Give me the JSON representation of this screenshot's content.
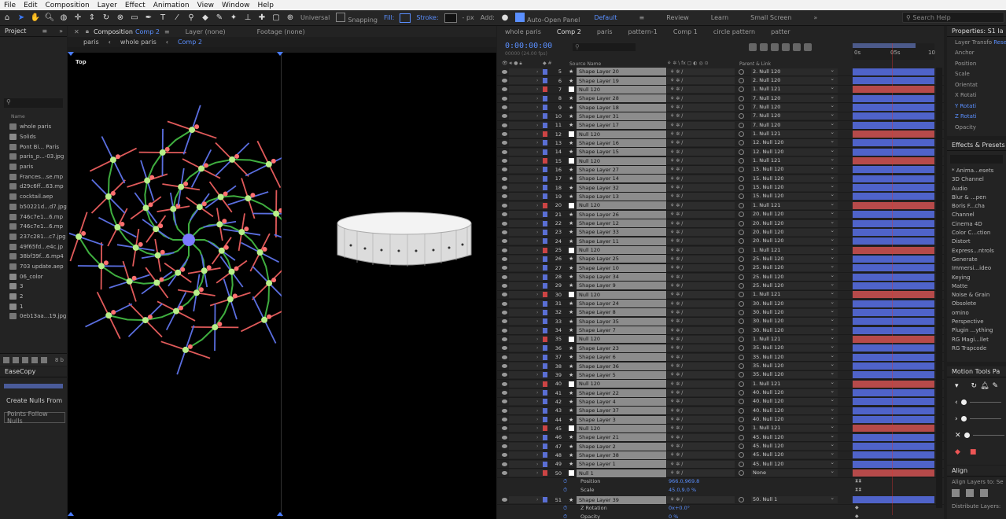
{
  "menubar": [
    "File",
    "Edit",
    "Composition",
    "Layer",
    "Effect",
    "Animation",
    "View",
    "Window",
    "Help"
  ],
  "toolbar": {
    "universal": "Universal",
    "snapping": "Snapping",
    "fill": "Fill:",
    "stroke": "Stroke:",
    "px": "- px",
    "add": "Add:",
    "auto_open": "Auto-Open Panel",
    "workspaces": [
      "Default",
      "Review",
      "Learn",
      "Small Screen"
    ],
    "search_help": "Search Help"
  },
  "project": {
    "title": "Project",
    "col_name": "Name",
    "items": [
      {
        "name": "whole paris",
        "type": "comp"
      },
      {
        "name": "Solids",
        "type": "folder"
      },
      {
        "name": "Pont Bi... Paris",
        "type": "file"
      },
      {
        "name": "paris_p...-03.jpg",
        "type": "file"
      },
      {
        "name": "paris",
        "type": "comp"
      },
      {
        "name": "Frances...se.mp",
        "type": "file"
      },
      {
        "name": "d29c6ff...63.mp",
        "type": "file"
      },
      {
        "name": "cocktail.aep",
        "type": "file"
      },
      {
        "name": "b50221d...d7.jpg",
        "type": "file"
      },
      {
        "name": "746c7e1...6.mp",
        "type": "file"
      },
      {
        "name": "746c7e1...6.mp",
        "type": "file"
      },
      {
        "name": "237c281...c7.jpg",
        "type": "file"
      },
      {
        "name": "49f65fd...e4c.jp",
        "type": "file"
      },
      {
        "name": "38bf39f...6.mp4",
        "type": "file"
      },
      {
        "name": "703 update.aep",
        "type": "file"
      },
      {
        "name": "06_color",
        "type": "folder"
      },
      {
        "name": "3",
        "type": "folder"
      },
      {
        "name": "2",
        "type": "folder"
      },
      {
        "name": "1",
        "type": "folder"
      },
      {
        "name": "0eb13aa...19.jpg",
        "type": "file"
      }
    ],
    "bpc": "8 b"
  },
  "easecopy": {
    "title": "EaseCopy",
    "create_nulls": "Create Nulls From",
    "points_follow": "Points Follow Nulls"
  },
  "viewer": {
    "tabs": [
      "Composition",
      "Comp 2",
      "Layer (none)",
      "Footage (none)"
    ],
    "breadcrumb": [
      "paris",
      "whole paris",
      "Comp 2"
    ],
    "camera": "Top"
  },
  "timeline": {
    "tabs": [
      "whole paris",
      "Comp 2",
      "paris",
      "pattern-1",
      "Comp 1",
      "circle pattern",
      "patter"
    ],
    "time": "0:00:00:00",
    "fps": "00000 (24.00 fps)",
    "col_source": "Source Name",
    "col_parent": "Parent & Link",
    "ruler": [
      "0s",
      "05s",
      "10"
    ],
    "layers": [
      {
        "n": "5",
        "name": "Shape Layer 20",
        "parent": "2. Null 120",
        "c": "#5a6fd4",
        "t": "s"
      },
      {
        "n": "6",
        "name": "Shape Layer 19",
        "parent": "2. Null 120",
        "c": "#5a6fd4",
        "t": "s"
      },
      {
        "n": "7",
        "name": "Null 120",
        "parent": "1. Null 121",
        "c": "#c44",
        "t": "n"
      },
      {
        "n": "8",
        "name": "Shape Layer 28",
        "parent": "7. Null 120",
        "c": "#5a6fd4",
        "t": "s"
      },
      {
        "n": "9",
        "name": "Shape Layer 18",
        "parent": "7. Null 120",
        "c": "#5a6fd4",
        "t": "s"
      },
      {
        "n": "10",
        "name": "Shape Layer 31",
        "parent": "7. Null 120",
        "c": "#5a6fd4",
        "t": "s"
      },
      {
        "n": "11",
        "name": "Shape Layer 17",
        "parent": "7. Null 120",
        "c": "#5a6fd4",
        "t": "s"
      },
      {
        "n": "12",
        "name": "Null 120",
        "parent": "1. Null 121",
        "c": "#c44",
        "t": "n"
      },
      {
        "n": "13",
        "name": "Shape Layer 16",
        "parent": "12. Null 120",
        "c": "#5a6fd4",
        "t": "s"
      },
      {
        "n": "14",
        "name": "Shape Layer 15",
        "parent": "12. Null 120",
        "c": "#5a6fd4",
        "t": "s"
      },
      {
        "n": "15",
        "name": "Null 120",
        "parent": "1. Null 121",
        "c": "#c44",
        "t": "n"
      },
      {
        "n": "16",
        "name": "Shape Layer 27",
        "parent": "15. Null 120",
        "c": "#5a6fd4",
        "t": "s"
      },
      {
        "n": "17",
        "name": "Shape Layer 14",
        "parent": "15. Null 120",
        "c": "#5a6fd4",
        "t": "s"
      },
      {
        "n": "18",
        "name": "Shape Layer 32",
        "parent": "15. Null 120",
        "c": "#5a6fd4",
        "t": "s"
      },
      {
        "n": "19",
        "name": "Shape Layer 13",
        "parent": "15. Null 120",
        "c": "#5a6fd4",
        "t": "s"
      },
      {
        "n": "20",
        "name": "Null 120",
        "parent": "1. Null 121",
        "c": "#c44",
        "t": "n"
      },
      {
        "n": "21",
        "name": "Shape Layer 26",
        "parent": "20. Null 120",
        "c": "#5a6fd4",
        "t": "s"
      },
      {
        "n": "22",
        "name": "Shape Layer 12",
        "parent": "20. Null 120",
        "c": "#5a6fd4",
        "t": "s"
      },
      {
        "n": "23",
        "name": "Shape Layer 33",
        "parent": "20. Null 120",
        "c": "#5a6fd4",
        "t": "s"
      },
      {
        "n": "24",
        "name": "Shape Layer 11",
        "parent": "20. Null 120",
        "c": "#5a6fd4",
        "t": "s"
      },
      {
        "n": "25",
        "name": "Null 120",
        "parent": "1. Null 121",
        "c": "#c44",
        "t": "n"
      },
      {
        "n": "26",
        "name": "Shape Layer 25",
        "parent": "25. Null 120",
        "c": "#5a6fd4",
        "t": "s"
      },
      {
        "n": "27",
        "name": "Shape Layer 10",
        "parent": "25. Null 120",
        "c": "#5a6fd4",
        "t": "s"
      },
      {
        "n": "28",
        "name": "Shape Layer 34",
        "parent": "25. Null 120",
        "c": "#5a6fd4",
        "t": "s"
      },
      {
        "n": "29",
        "name": "Shape Layer 9",
        "parent": "25. Null 120",
        "c": "#5a6fd4",
        "t": "s"
      },
      {
        "n": "30",
        "name": "Null 120",
        "parent": "1. Null 121",
        "c": "#c44",
        "t": "n"
      },
      {
        "n": "31",
        "name": "Shape Layer 24",
        "parent": "30. Null 120",
        "c": "#5a6fd4",
        "t": "s"
      },
      {
        "n": "32",
        "name": "Shape Layer 8",
        "parent": "30. Null 120",
        "c": "#5a6fd4",
        "t": "s"
      },
      {
        "n": "33",
        "name": "Shape Layer 35",
        "parent": "30. Null 120",
        "c": "#5a6fd4",
        "t": "s"
      },
      {
        "n": "34",
        "name": "Shape Layer 7",
        "parent": "30. Null 120",
        "c": "#5a6fd4",
        "t": "s"
      },
      {
        "n": "35",
        "name": "Null 120",
        "parent": "1. Null 121",
        "c": "#c44",
        "t": "n"
      },
      {
        "n": "36",
        "name": "Shape Layer 23",
        "parent": "35. Null 120",
        "c": "#5a6fd4",
        "t": "s"
      },
      {
        "n": "37",
        "name": "Shape Layer 6",
        "parent": "35. Null 120",
        "c": "#5a6fd4",
        "t": "s"
      },
      {
        "n": "38",
        "name": "Shape Layer 36",
        "parent": "35. Null 120",
        "c": "#5a6fd4",
        "t": "s"
      },
      {
        "n": "39",
        "name": "Shape Layer 5",
        "parent": "35. Null 120",
        "c": "#5a6fd4",
        "t": "s"
      },
      {
        "n": "40",
        "name": "Null 120",
        "parent": "1. Null 121",
        "c": "#c44",
        "t": "n"
      },
      {
        "n": "41",
        "name": "Shape Layer 22",
        "parent": "40. Null 120",
        "c": "#5a6fd4",
        "t": "s"
      },
      {
        "n": "42",
        "name": "Shape Layer 4",
        "parent": "40. Null 120",
        "c": "#5a6fd4",
        "t": "s"
      },
      {
        "n": "43",
        "name": "Shape Layer 37",
        "parent": "40. Null 120",
        "c": "#5a6fd4",
        "t": "s"
      },
      {
        "n": "44",
        "name": "Shape Layer 3",
        "parent": "40. Null 120",
        "c": "#5a6fd4",
        "t": "s"
      },
      {
        "n": "45",
        "name": "Null 120",
        "parent": "1. Null 121",
        "c": "#c44",
        "t": "n"
      },
      {
        "n": "46",
        "name": "Shape Layer 21",
        "parent": "45. Null 120",
        "c": "#5a6fd4",
        "t": "s"
      },
      {
        "n": "47",
        "name": "Shape Layer 2",
        "parent": "45. Null 120",
        "c": "#5a6fd4",
        "t": "s"
      },
      {
        "n": "48",
        "name": "Shape Layer 38",
        "parent": "45. Null 120",
        "c": "#5a6fd4",
        "t": "s"
      },
      {
        "n": "49",
        "name": "Shape Layer 1",
        "parent": "45. Null 120",
        "c": "#5a6fd4",
        "t": "s"
      },
      {
        "n": "50",
        "name": "Null 1",
        "parent": "None",
        "c": "#c44",
        "t": "n"
      }
    ],
    "null1_props": [
      {
        "name": "Position",
        "value": "966.0,969.8"
      },
      {
        "name": "Scale",
        "value": "45.0,9.0 %"
      }
    ],
    "layer51": {
      "n": "51",
      "name": "Shape Layer 39",
      "parent": "50. Null 1"
    },
    "layer51_props": [
      {
        "name": "Z Rotation",
        "value": "0x+0.0°"
      },
      {
        "name": "Opacity",
        "value": "0 %"
      }
    ]
  },
  "properties": {
    "title": "Properties: S1 la",
    "layer_transform": "Layer Transfo",
    "reset": "Reset",
    "items": [
      "Anchor",
      "Position",
      "Scale",
      "Orientat",
      "X Rotati",
      "Y Rotati",
      "Z Rotati",
      "Opacity"
    ]
  },
  "effects": {
    "title": "Effects & Presets",
    "items": [
      "* Anima...esets",
      "3D Channel",
      "Audio",
      "Blur & ...pen",
      "Boris F...cha",
      "Channel",
      "Cinema 4D",
      "Color C...ction",
      "Distort",
      "Express...ntrols",
      "Generate",
      "Immersi...ideo",
      "Keying",
      "Matte",
      "Noise & Grain",
      "Obsolete",
      "omino",
      "Perspective",
      "Plugin ...ything",
      "RG Magi...llet",
      "RG Trapcode"
    ]
  },
  "motion_tools": {
    "title": "Motion Tools Pa"
  },
  "align": {
    "title": "Align",
    "align_to": "Align Layers to:",
    "align_to_val": "Se",
    "distribute": "Distribute Layers:"
  }
}
